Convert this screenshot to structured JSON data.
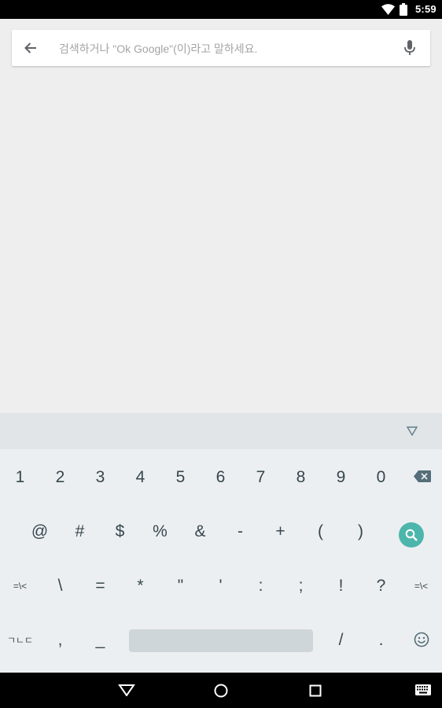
{
  "status_bar": {
    "time": "5:59"
  },
  "search": {
    "placeholder": "검색하거나 \"Ok Google\"(이)라고 말하세요."
  },
  "keyboard": {
    "row1": [
      "1",
      "2",
      "3",
      "4",
      "5",
      "6",
      "7",
      "8",
      "9",
      "0"
    ],
    "row2": [
      "@",
      "#",
      "$",
      "%",
      "&",
      "-",
      "+",
      "(",
      ")"
    ],
    "row3": [
      "=\\<",
      "\\",
      "=",
      "*",
      "\"",
      "'",
      ":",
      ";",
      "!",
      "?",
      "=\\<"
    ],
    "row4": [
      "ㄱㄴㄷ",
      ",",
      "_",
      "/",
      "."
    ]
  },
  "icons": {
    "back": "arrow-back-icon",
    "mic": "mic-icon",
    "hide_keyboard": "triangle-down-icon",
    "backspace": "backspace-icon",
    "search": "search-icon",
    "emoji": "emoji-icon",
    "nav_back": "nav-back-icon",
    "nav_home": "nav-home-icon",
    "nav_recents": "nav-recents-icon",
    "nav_keyboard": "keyboard-icon"
  },
  "colors": {
    "accent": "#4db6ac",
    "key_text": "#37474f"
  }
}
